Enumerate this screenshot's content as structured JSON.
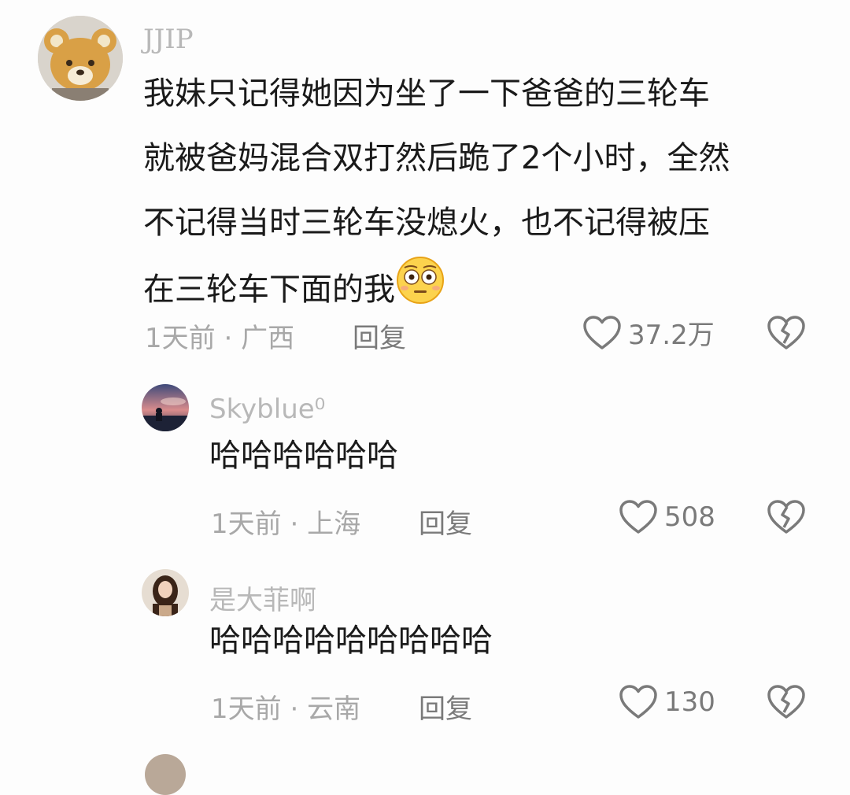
{
  "comments": [
    {
      "username": "JJIP",
      "text_lines": [
        "我妹只记得她因为坐了一下爸爸的三轮车",
        "就被爸妈混合双打然后跪了2个小时，全然",
        "不记得当时三轮车没熄火，也不记得被压",
        "在三轮车下面的我"
      ],
      "emoji": "flushed-face",
      "time": "1天前",
      "location": "广西",
      "reply_label": "回复",
      "likes": "37.2万"
    },
    {
      "username": "Skyblue⁰",
      "text": "哈哈哈哈哈哈",
      "time": "1天前",
      "location": "上海",
      "reply_label": "回复",
      "likes": "508"
    },
    {
      "username": "是大菲啊",
      "text": "哈哈哈哈哈哈哈哈哈",
      "time": "1天前",
      "location": "云南",
      "reply_label": "回复",
      "likes": "130"
    }
  ],
  "separator": "·",
  "colors": {
    "username": "#b8b8b8",
    "text": "#1a1a1a",
    "meta": "#a8a8a8",
    "icon": "#7a7a7a"
  }
}
